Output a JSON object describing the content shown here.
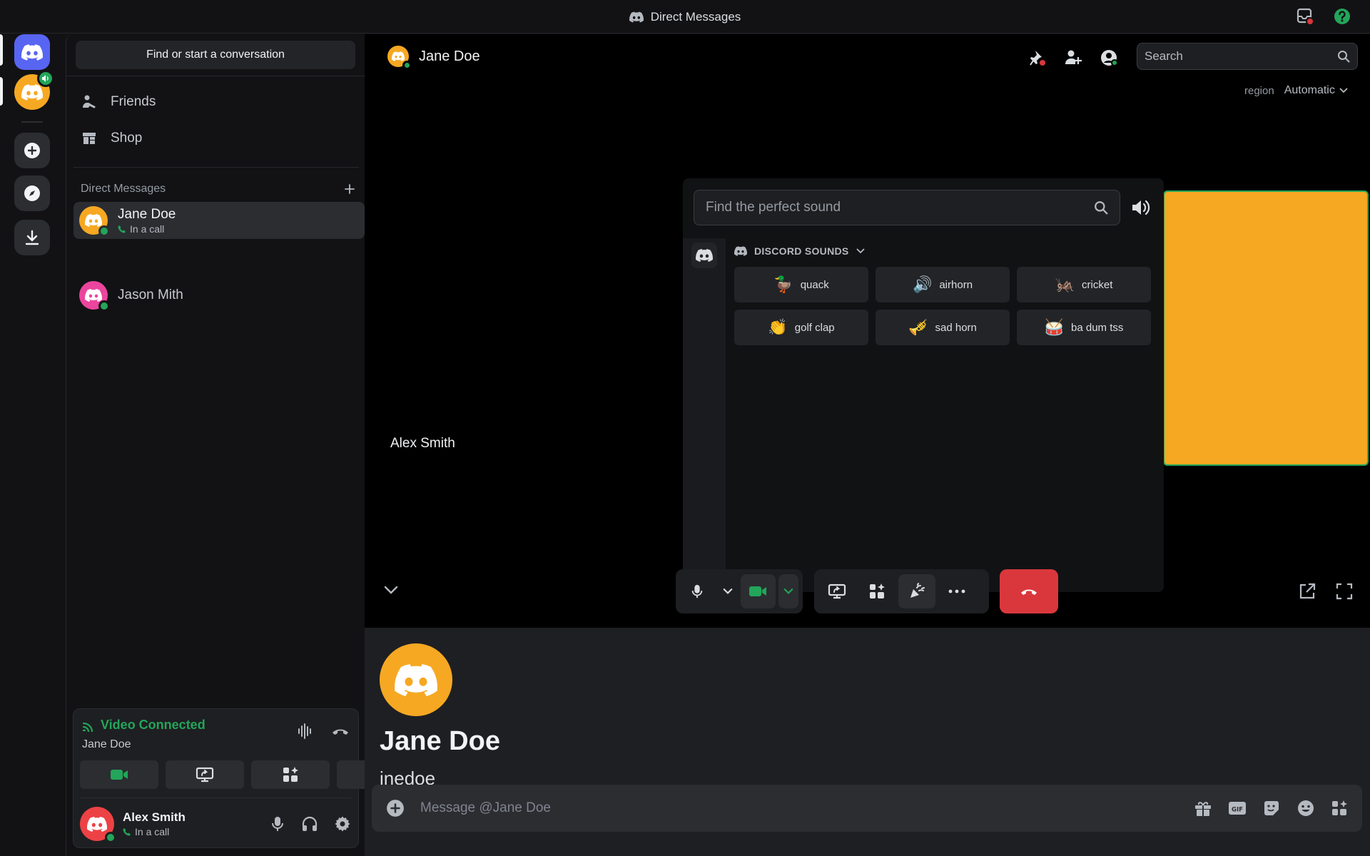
{
  "titlebar": {
    "title": "Direct Messages"
  },
  "sidebar": {
    "find_label": "Find or start a conversation",
    "nav": [
      {
        "label": "Friends",
        "icon": "friends-icon"
      },
      {
        "label": "Shop",
        "icon": "shop-icon"
      }
    ],
    "dm_header": "Direct Messages",
    "dms": [
      {
        "name": "Jane Doe",
        "status": "In a call",
        "color": "#f6a822"
      },
      {
        "name": "Jason Mith",
        "color": "#eb459e"
      }
    ]
  },
  "voice_panel": {
    "title": "Video Connected",
    "subtitle": "Jane Doe"
  },
  "user": {
    "name": "Alex Smith",
    "status": "In a call",
    "color": "#ed4245"
  },
  "call": {
    "header_name": "Jane Doe",
    "search_placeholder": "Search",
    "region_label": "region",
    "region_value": "Automatic",
    "participant_label": "Alex Smith"
  },
  "soundboard": {
    "search_placeholder": "Find the perfect sound",
    "category": "DISCORD SOUNDS",
    "sounds": [
      {
        "label": "quack",
        "emoji": "🦆"
      },
      {
        "label": "airhorn",
        "emoji": "🔊"
      },
      {
        "label": "cricket",
        "emoji": "🦗"
      },
      {
        "label": "golf clap",
        "emoji": "👏"
      },
      {
        "label": "sad horn",
        "emoji": "🎺"
      },
      {
        "label": "ba dum tss",
        "emoji": "🥁"
      }
    ]
  },
  "chat": {
    "name": "Jane Doe",
    "username": "jnedoe",
    "composer_placeholder": "Message @Jane Doe"
  },
  "colors": {
    "accent": "#5865f2",
    "green": "#23a55a",
    "red": "#da373c",
    "orange": "#f6a822"
  }
}
